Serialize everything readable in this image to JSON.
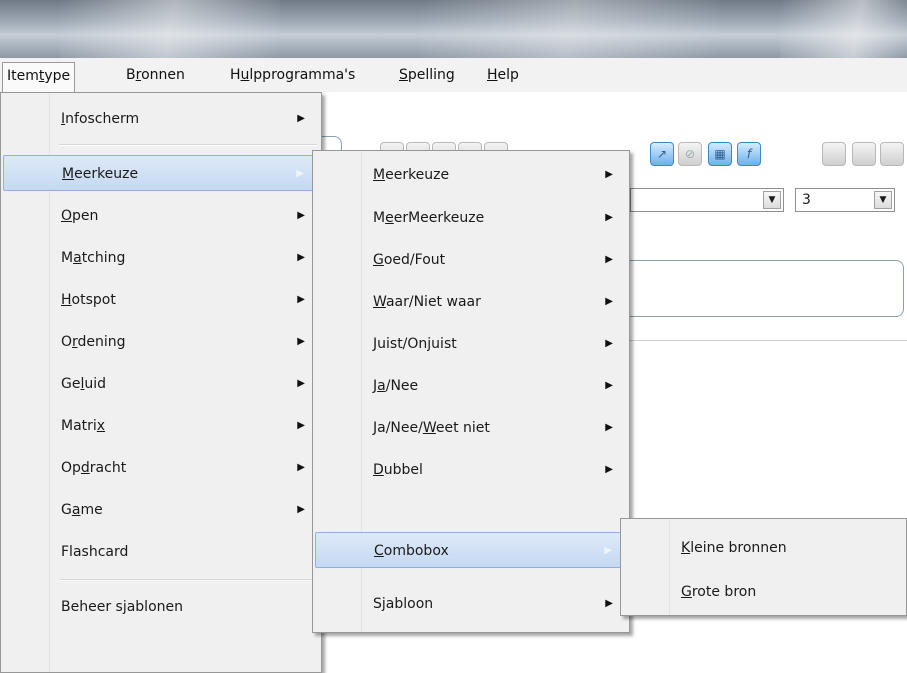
{
  "menubar": [
    {
      "pre": "Item",
      "acc": "t",
      "post": "ype",
      "open": true
    },
    {
      "pre": "B",
      "acc": "r",
      "post": "onnen",
      "open": false
    },
    {
      "pre": "H",
      "acc": "u",
      "post": "lpprogramma's",
      "open": false
    },
    {
      "pre": "",
      "acc": "S",
      "post": "pelling",
      "open": false
    },
    {
      "pre": "",
      "acc": "H",
      "post": "elp",
      "open": false
    }
  ],
  "toolbar": {
    "combo_value": "3"
  },
  "menu1": {
    "items": [
      {
        "pre": "",
        "acc": "I",
        "post": "nfoscherm",
        "sub": true
      },
      {
        "pre": "",
        "acc": "M",
        "post": "eerkeuze",
        "sub": true,
        "highlighted": true
      },
      {
        "pre": "",
        "acc": "O",
        "post": "pen",
        "sub": true
      },
      {
        "pre": "M",
        "acc": "a",
        "post": "tching",
        "sub": true
      },
      {
        "pre": "",
        "acc": "H",
        "post": "otspot",
        "sub": true
      },
      {
        "pre": "O",
        "acc": "r",
        "post": "dening",
        "sub": true
      },
      {
        "pre": "Ge",
        "acc": "l",
        "post": "uid",
        "sub": true
      },
      {
        "pre": "Matri",
        "acc": "x",
        "post": "",
        "sub": true
      },
      {
        "pre": "Op",
        "acc": "d",
        "post": "racht",
        "sub": true
      },
      {
        "pre": "G",
        "acc": "a",
        "post": "me",
        "sub": true
      },
      {
        "pre": "Flashcard",
        "acc": "",
        "post": "",
        "sub": false
      },
      {
        "pre": "Beheer sjablonen",
        "acc": "",
        "post": "",
        "sub": false
      }
    ]
  },
  "menu2": {
    "items": [
      {
        "pre": "",
        "acc": "M",
        "post": "eerkeuze",
        "sub": true
      },
      {
        "pre": "M",
        "acc": "e",
        "post": "erMeerkeuze",
        "sub": true
      },
      {
        "pre": "",
        "acc": "G",
        "post": "oed/Fout",
        "sub": true
      },
      {
        "pre": "",
        "acc": "W",
        "post": "aar/Niet waar",
        "sub": true
      },
      {
        "pre": "",
        "acc": "J",
        "post": "uist/Onjuist",
        "sub": true
      },
      {
        "pre": "J",
        "acc": "a",
        "post": "/Nee",
        "sub": true
      },
      {
        "pre": "Ja/Nee/",
        "acc": "W",
        "post": "eet niet",
        "sub": true
      },
      {
        "pre": "",
        "acc": "D",
        "post": "ubbel",
        "sub": true
      },
      {
        "pre": "",
        "acc": "C",
        "post": "ombobox",
        "sub": true,
        "highlighted": true
      },
      {
        "pre": "Sjabloon",
        "acc": "",
        "post": "",
        "sub": true
      }
    ]
  },
  "menu3": {
    "items": [
      {
        "pre": "",
        "acc": "K",
        "post": "leine bronnen",
        "sub": false
      },
      {
        "pre": "",
        "acc": "G",
        "post": "rote bron",
        "sub": false
      }
    ]
  },
  "icons": {
    "submenu_arrow": "triangle-right-icon"
  },
  "colors": {
    "menu_bg": "#f0f0f0",
    "highlight_bg": "#c5d9f3",
    "highlight_border": "#8fb1df"
  }
}
